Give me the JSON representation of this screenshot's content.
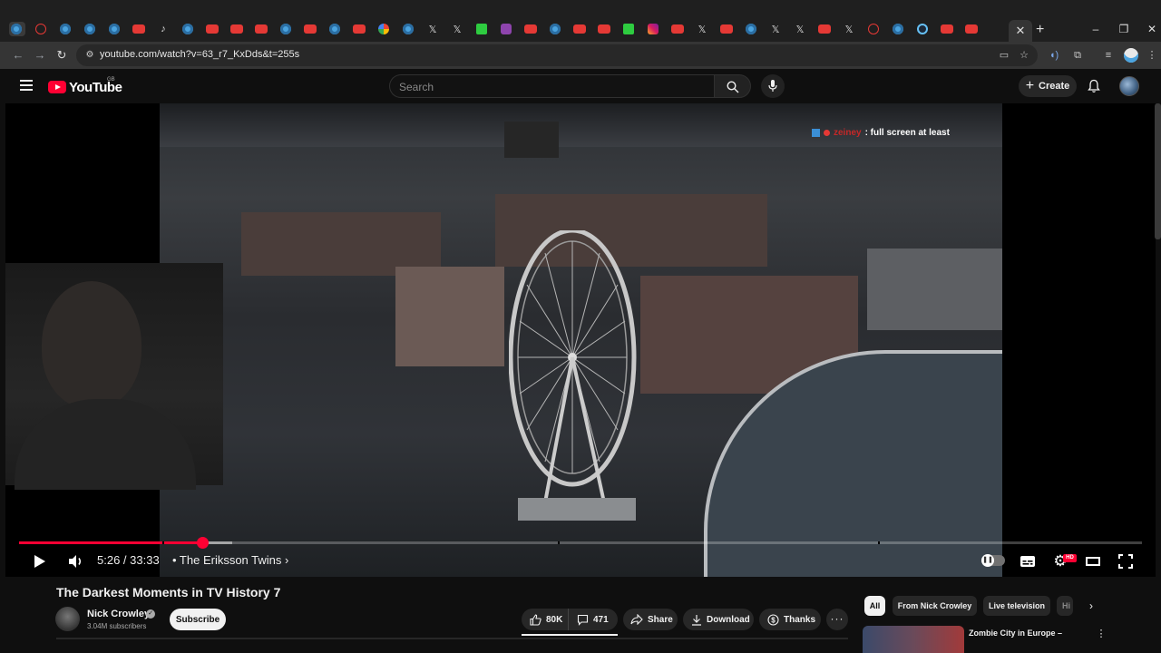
{
  "browser": {
    "url": "youtube.com/watch?v=63_r7_KxDds&t=255s",
    "tabs": [
      {
        "icon": "chromium-icon",
        "type": "blue"
      },
      {
        "icon": "chrome-icon",
        "type": "ghost"
      },
      {
        "icon": "chromium-icon",
        "type": "blue"
      },
      {
        "icon": "chromium-icon",
        "type": "blue"
      },
      {
        "icon": "chromium-icon",
        "type": "blue"
      },
      {
        "icon": "youtube-icon",
        "type": "red"
      },
      {
        "icon": "tiktok-icon",
        "type": "glyph",
        "glyph": "♪"
      },
      {
        "icon": "chromium-icon",
        "type": "blue"
      },
      {
        "icon": "youtube-icon",
        "type": "red"
      },
      {
        "icon": "youtube-icon",
        "type": "red"
      },
      {
        "icon": "youtube-icon",
        "type": "red"
      },
      {
        "icon": "chromium-icon",
        "type": "blue"
      },
      {
        "icon": "youtube-icon",
        "type": "red"
      },
      {
        "icon": "chromium-icon",
        "type": "blue"
      },
      {
        "icon": "youtube-icon",
        "type": "red"
      },
      {
        "icon": "google-icon",
        "type": "google"
      },
      {
        "icon": "chromium-icon",
        "type": "blue"
      },
      {
        "icon": "x-icon",
        "type": "glyph",
        "glyph": "𝕏"
      },
      {
        "icon": "x-icon",
        "type": "glyph",
        "glyph": "𝕏"
      },
      {
        "icon": "kick-icon",
        "type": "green"
      },
      {
        "icon": "twitch-icon",
        "type": "purple"
      },
      {
        "icon": "youtube-icon",
        "type": "red"
      },
      {
        "icon": "chromium-icon",
        "type": "blue"
      },
      {
        "icon": "youtube-icon",
        "type": "red"
      },
      {
        "icon": "youtube-icon",
        "type": "red"
      },
      {
        "icon": "kick-icon",
        "type": "green"
      },
      {
        "icon": "instagram-icon",
        "type": "insta"
      },
      {
        "icon": "youtube-icon",
        "type": "red"
      },
      {
        "icon": "x-icon",
        "type": "glyph",
        "glyph": "𝕏"
      },
      {
        "icon": "youtube-icon",
        "type": "red"
      },
      {
        "icon": "chromium-icon",
        "type": "blue"
      },
      {
        "icon": "x-icon",
        "type": "glyph",
        "glyph": "𝕏"
      },
      {
        "icon": "x-icon",
        "type": "glyph",
        "glyph": "𝕏"
      },
      {
        "icon": "youtube-icon",
        "type": "red"
      },
      {
        "icon": "x-icon",
        "type": "glyph",
        "glyph": "𝕏"
      },
      {
        "icon": "ghost-icon",
        "type": "ghost"
      },
      {
        "icon": "feather-icon",
        "type": "blue"
      },
      {
        "icon": "steam-icon",
        "type": "steam"
      },
      {
        "icon": "youtube-icon",
        "type": "red"
      },
      {
        "icon": "youtube-icon",
        "type": "red"
      }
    ]
  },
  "youtube": {
    "logo_text": "YouTube",
    "region": "GB",
    "search_placeholder": "Search",
    "create_label": "Create"
  },
  "player": {
    "chat_overlay_user": "zeiney",
    "chat_overlay_text": ": full screen at least",
    "time_display": "5:26 / 33:33",
    "chapter_label": "• The Eriksson Twins ›",
    "progress_fraction": 0.163,
    "buffer_fraction": 0.19,
    "chapter_markers": [
      0.128,
      0.48,
      0.765
    ],
    "hd_badge": "HD",
    "autoplay_on": false
  },
  "video": {
    "title": "The Darkest Moments in TV History 7",
    "channel_name": "Nick Crowley",
    "subscribers": "3.04M subscribers",
    "subscribe_label": "Subscribe",
    "likes": "80K",
    "comments": "471",
    "share_label": "Share",
    "download_label": "Download",
    "thanks_label": "Thanks"
  },
  "chips": [
    {
      "label": "All",
      "active": true
    },
    {
      "label": "From Nick Crowley",
      "active": false
    },
    {
      "label": "Live television",
      "active": false
    },
    {
      "label": "Hi",
      "active": false
    }
  ],
  "up_next": {
    "title": "Zombie City in Europe –"
  },
  "colors": {
    "accent": "#ff0033",
    "background": "#0f0f0f",
    "pill": "#272727"
  }
}
